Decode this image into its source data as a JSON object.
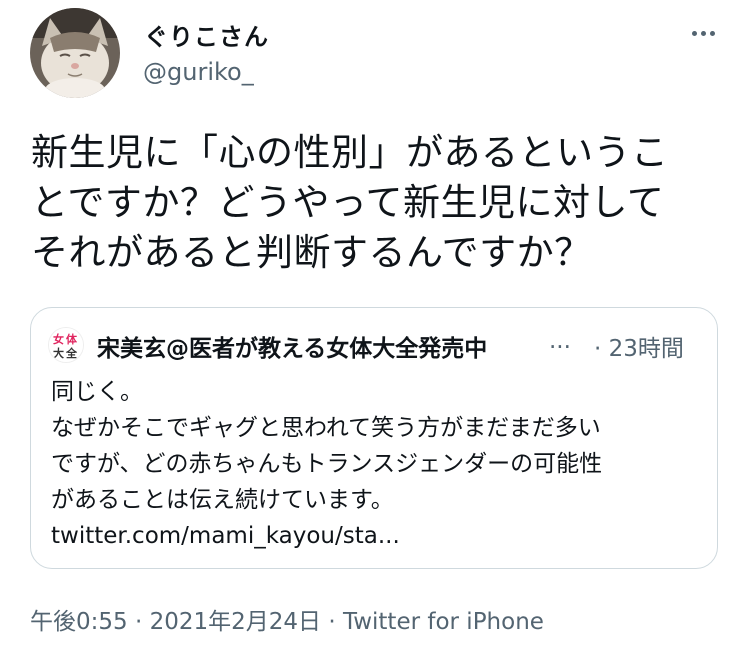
{
  "author": {
    "display_name": "ぐりこさん",
    "handle": "@guriko_"
  },
  "tweet": {
    "lines": [
      "新生児に「心の性別」があるというこ",
      "とですか？どうやって新生児に対して",
      "それがあると判断するんですか？"
    ]
  },
  "quote": {
    "avatar_text": [
      "女",
      "体",
      "大",
      "全"
    ],
    "author_name": "宋美玄@医者が教える女体大全発売中",
    "ellipsis": "...",
    "time": "· 23時間",
    "lines": [
      "同じく。",
      "なぜかそこでギャグと思われて笑う方がまだまだ多い",
      "ですが、どの赤ちゃんもトランスジェンダーの可能性",
      "があることは伝え続けています。",
      "twitter.com/mami_kayou/sta..."
    ]
  },
  "meta": {
    "time": "午後0:55",
    "separator1": " · ",
    "date": "2021年2月24日",
    "separator2": " · ",
    "source": "Twitter for iPhone"
  },
  "colors": {
    "text": "#0f1419",
    "secondary": "#536471",
    "border": "#cfd9de",
    "accent": "#e0245e"
  },
  "icons": {
    "more": "more-horizontal-icon"
  }
}
